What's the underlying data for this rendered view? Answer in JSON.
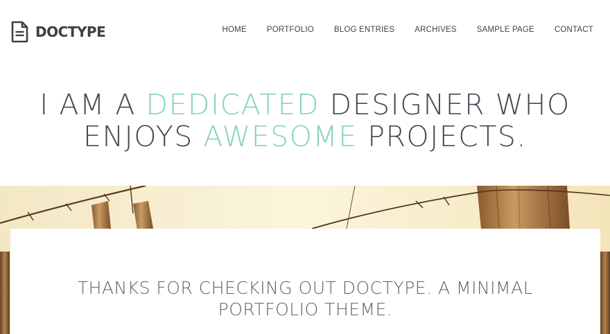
{
  "brand": {
    "name": "DOCTYPE",
    "icon": "document-icon"
  },
  "nav": {
    "items": [
      {
        "label": "HOME"
      },
      {
        "label": "PORTFOLIO"
      },
      {
        "label": "BLOG ENTRIES"
      },
      {
        "label": "ARCHIVES"
      },
      {
        "label": "SAMPLE PAGE"
      },
      {
        "label": "CONTACT"
      }
    ]
  },
  "hero": {
    "line1_a": "I AM A ",
    "line1_accent": "DEDICATED",
    "line1_b": " DESIGNER WHO",
    "line2_a": "ENJOYS ",
    "line2_accent": "AWESOME",
    "line2_b": " PROJECTS."
  },
  "intro": {
    "line1": "THANKS FOR CHECKING OUT DOCTYPE. A MINIMAL",
    "line2": "PORTFOLIO THEME."
  },
  "colors": {
    "accent": "#86d4b9",
    "text": "#454b53",
    "brand": "#3a4048"
  }
}
